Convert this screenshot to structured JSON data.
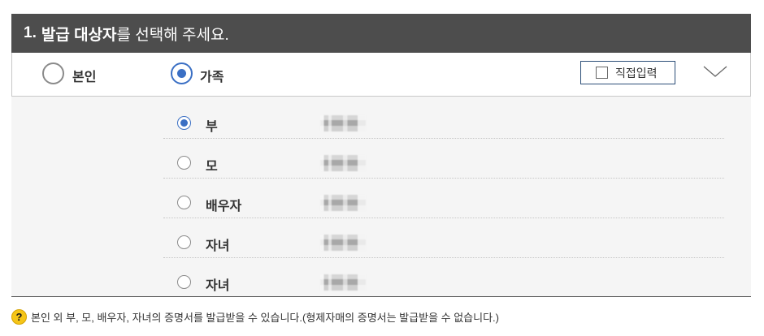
{
  "header": {
    "number": "1.",
    "title_bold": "발급 대상자",
    "title_rest": "를 선택해 주세요."
  },
  "target_options": [
    {
      "label": "본인",
      "selected": false
    },
    {
      "label": "가족",
      "selected": true
    }
  ],
  "direct_input": {
    "label": "직접입력",
    "checked": false
  },
  "family_members": [
    {
      "relation": "부",
      "selected": true
    },
    {
      "relation": "모",
      "selected": false
    },
    {
      "relation": "배우자",
      "selected": false
    },
    {
      "relation": "자녀",
      "selected": false
    },
    {
      "relation": "자녀",
      "selected": false
    }
  ],
  "notice": {
    "icon": "question-icon",
    "text": "본인 외 부, 모, 배우자, 자녀의 증명서를 발급받을 수 있습니다.(형제자매의 증명서는 발급받을 수 없습니다.)"
  },
  "colors": {
    "header_bg": "#4d4d4d",
    "accent": "#3a6fc4",
    "button_border": "#2c4e77",
    "help_icon": "#f5c518"
  }
}
